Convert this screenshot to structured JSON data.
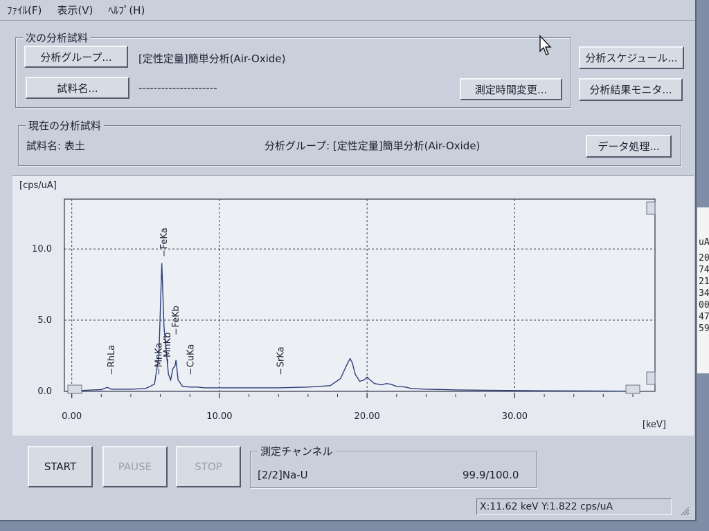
{
  "menu": [
    "ﾌｧｲﾙ(F)",
    "表示(V)",
    "ﾍﾙﾌﾟ(H)"
  ],
  "next_sample": {
    "title": "次の分析試料",
    "group_button": "分析グループ...",
    "group_value": "[定性定量]簡単分析(Air-Oxide)",
    "sample_button": "試料名...",
    "sample_value": "---------------------",
    "change_time_button": "測定時間変更..."
  },
  "side_buttons": {
    "schedule": "分析スケジュール...",
    "monitor": "分析結果モニタ..."
  },
  "current_sample": {
    "title": "現在の分析試料",
    "sample_label": "試料名: 表土",
    "group_label": "分析グループ: [定性定量]簡単分析(Air-Oxide)",
    "data_button": "データ処理..."
  },
  "chart_data": {
    "type": "line",
    "ylabel": "[cps/uA]",
    "xlabel": "[keV]",
    "xlim": [
      -0.5,
      39.5
    ],
    "ylim": [
      0,
      13.5
    ],
    "x_ticks": [
      0,
      10,
      20,
      30
    ],
    "x_tick_labels": [
      "0.00",
      "10.00",
      "20.00",
      "30.00"
    ],
    "y_ticks": [
      0,
      5,
      10
    ],
    "y_tick_labels": [
      "0.0",
      "5.0",
      "10.0"
    ],
    "grid": true,
    "series": [
      {
        "x": [
          0.0,
          0.5,
          1.0,
          1.5,
          2.0,
          2.4,
          2.7,
          3.0,
          4.0,
          5.0,
          5.6,
          5.9,
          6.1,
          6.25,
          6.4,
          6.55,
          6.7,
          6.85,
          7.0,
          7.06,
          7.2,
          7.5,
          8.0,
          8.5,
          9.0,
          10.0,
          12.0,
          14.0,
          16.0,
          17.5,
          18.2,
          18.6,
          18.85,
          19.0,
          19.2,
          19.5,
          19.8,
          20.0,
          20.2,
          20.5,
          21.0,
          21.3,
          21.6,
          22.0,
          22.6,
          23.0,
          24.0,
          26.0,
          28.0,
          30.0,
          32.0,
          35.0,
          38.5
        ],
        "y": [
          0.0,
          0.05,
          0.08,
          0.1,
          0.12,
          0.28,
          0.15,
          0.15,
          0.15,
          0.2,
          0.5,
          2.5,
          9.0,
          4.5,
          2.8,
          1.2,
          0.8,
          1.6,
          1.8,
          2.2,
          0.8,
          0.35,
          0.3,
          0.3,
          0.25,
          0.25,
          0.25,
          0.25,
          0.3,
          0.4,
          0.9,
          1.8,
          2.3,
          2.0,
          1.2,
          0.7,
          0.8,
          1.0,
          0.8,
          0.55,
          0.45,
          0.55,
          0.5,
          0.35,
          0.3,
          0.2,
          0.15,
          0.1,
          0.08,
          0.06,
          0.04,
          0.03,
          0.0
        ]
      }
    ],
    "peak_markers": [
      {
        "label": "RhLa",
        "x": 2.7,
        "y": 1.2
      },
      {
        "label": "MnKa",
        "x": 5.9,
        "y": 1.2
      },
      {
        "label": "MnKb",
        "x": 6.49,
        "y": 1.9
      },
      {
        "label": "FeKa",
        "x": 6.25,
        "y": 9.5
      },
      {
        "label": "FeKb",
        "x": 7.06,
        "y": 4.0
      },
      {
        "label": "CuKa",
        "x": 8.05,
        "y": 1.2
      },
      {
        "label": "SrKa",
        "x": 14.16,
        "y": 1.2
      }
    ]
  },
  "controls": {
    "start": "START",
    "pause": "PAUSE",
    "stop": "STOP"
  },
  "channel": {
    "title": "測定チャンネル",
    "name": "[2/2]Na-U",
    "progress": "99.9/100.0"
  },
  "status": {
    "readout": "X:11.62 keV  Y:1.822 cps/uA"
  },
  "edge_text": [
    "uA",
    "20",
    "74",
    "21",
    "34",
    "00",
    "47",
    "59"
  ]
}
